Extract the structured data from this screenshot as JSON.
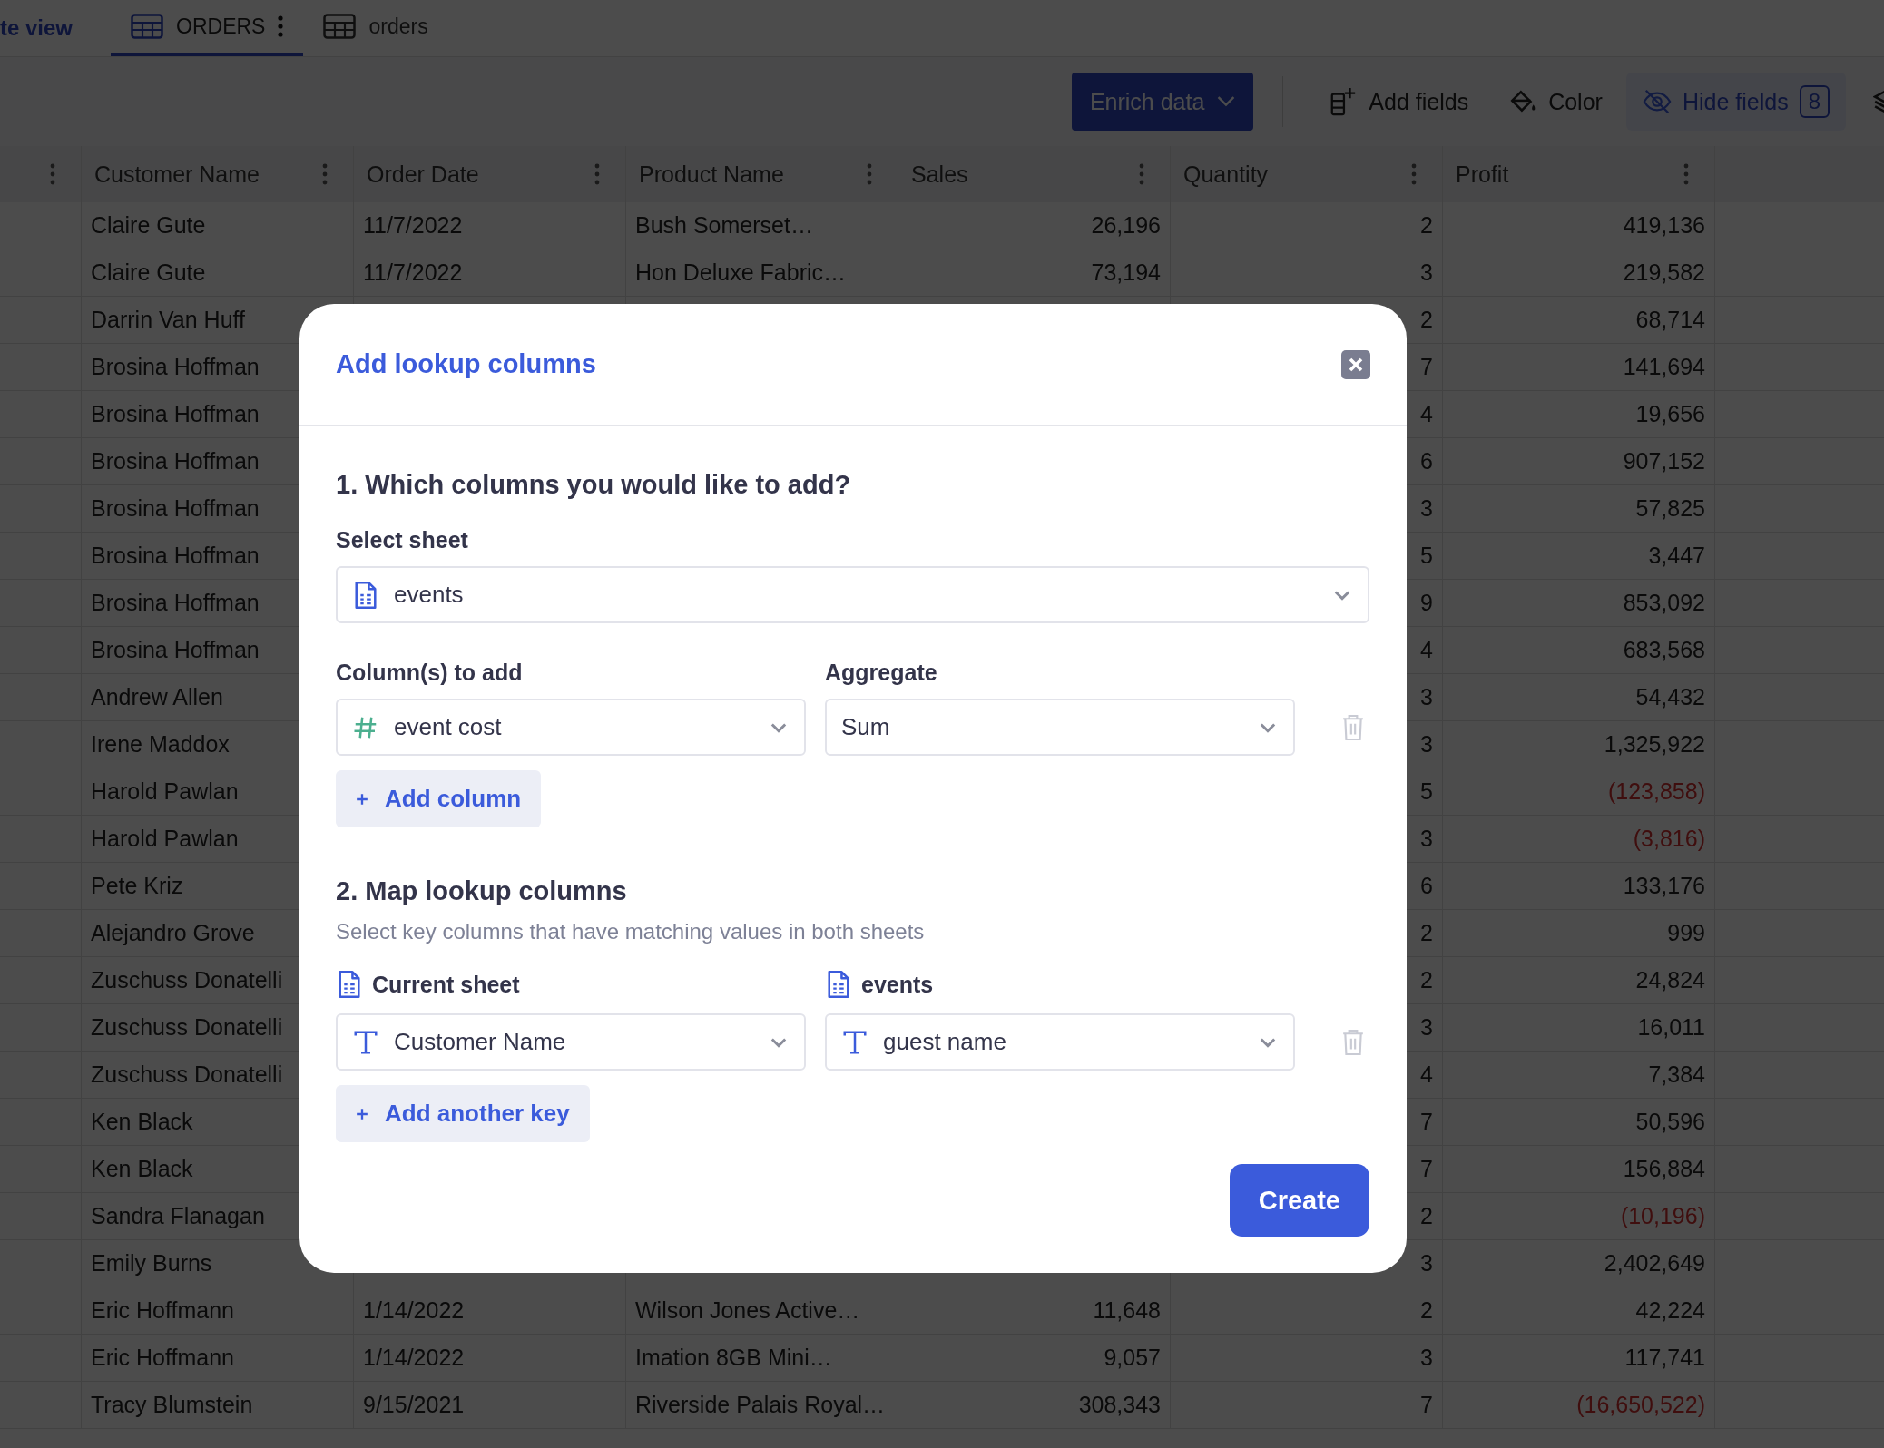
{
  "view_link": "te view",
  "tabs": [
    {
      "label": "ORDERS",
      "selected": true,
      "menu": true
    },
    {
      "label": "orders",
      "selected": false,
      "menu": false
    }
  ],
  "toolbar": {
    "enrich": "Enrich data",
    "add_fields": "Add fields",
    "color_label": "Color",
    "hide_fields": "Hide fields",
    "hidden_count": "8"
  },
  "table": {
    "columns": [
      "Customer Name",
      "Order Date",
      "Product Name",
      "Sales",
      "Quantity",
      "Profit"
    ],
    "rows": [
      {
        "cells": [
          "Claire Gute",
          "11/7/2022",
          "Bush Somerset…",
          "26,196",
          "2",
          "419,136"
        ],
        "negative": false
      },
      {
        "cells": [
          "Claire Gute",
          "11/7/2022",
          "Hon Deluxe Fabric…",
          "73,194",
          "3",
          "219,582"
        ],
        "negative": false
      },
      {
        "cells": [
          "Darrin Van Huff",
          "",
          "",
          "",
          "2",
          "68,714"
        ],
        "negative": false
      },
      {
        "cells": [
          "Brosina Hoffman",
          "",
          "",
          "",
          "7",
          "141,694"
        ],
        "negative": false
      },
      {
        "cells": [
          "Brosina Hoffman",
          "",
          "",
          "",
          "4",
          "19,656"
        ],
        "negative": false
      },
      {
        "cells": [
          "Brosina Hoffman",
          "",
          "",
          "",
          "6",
          "907,152"
        ],
        "negative": false
      },
      {
        "cells": [
          "Brosina Hoffman",
          "",
          "",
          "",
          "3",
          "57,825"
        ],
        "negative": false
      },
      {
        "cells": [
          "Brosina Hoffman",
          "",
          "",
          "",
          "5",
          "3,447"
        ],
        "negative": false
      },
      {
        "cells": [
          "Brosina Hoffman",
          "",
          "",
          "",
          "9",
          "853,092"
        ],
        "negative": false
      },
      {
        "cells": [
          "Brosina Hoffman",
          "",
          "",
          "",
          "4",
          "683,568"
        ],
        "negative": false
      },
      {
        "cells": [
          "Andrew Allen",
          "",
          "",
          "",
          "3",
          "54,432"
        ],
        "negative": false
      },
      {
        "cells": [
          "Irene Maddox",
          "",
          "",
          "",
          "3",
          "1,325,922"
        ],
        "negative": false
      },
      {
        "cells": [
          "Harold Pawlan",
          "",
          "",
          "",
          "5",
          "(123,858)"
        ],
        "negative": true
      },
      {
        "cells": [
          "Harold Pawlan",
          "",
          "",
          "",
          "3",
          "(3,816)"
        ],
        "negative": true
      },
      {
        "cells": [
          "Pete Kriz",
          "",
          "",
          "",
          "6",
          "133,176"
        ],
        "negative": false
      },
      {
        "cells": [
          "Alejandro Grove",
          "",
          "",
          "",
          "2",
          "999"
        ],
        "negative": false
      },
      {
        "cells": [
          "Zuschuss Donatelli",
          "",
          "",
          "",
          "2",
          "24,824"
        ],
        "negative": false
      },
      {
        "cells": [
          "Zuschuss Donatelli",
          "",
          "",
          "",
          "3",
          "16,011"
        ],
        "negative": false
      },
      {
        "cells": [
          "Zuschuss Donatelli",
          "",
          "",
          "",
          "4",
          "7,384"
        ],
        "negative": false
      },
      {
        "cells": [
          "Ken Black",
          "",
          "",
          "",
          "7",
          "50,596"
        ],
        "negative": false
      },
      {
        "cells": [
          "Ken Black",
          "",
          "",
          "",
          "7",
          "156,884"
        ],
        "negative": false
      },
      {
        "cells": [
          "Sandra Flanagan",
          "",
          "",
          "",
          "2",
          "(10,196)"
        ],
        "negative": true
      },
      {
        "cells": [
          "Emily Burns",
          "",
          "",
          "",
          "3",
          "2,402,649"
        ],
        "negative": false
      },
      {
        "cells": [
          "Eric Hoffmann",
          "1/14/2022",
          "Wilson Jones Active…",
          "11,648",
          "2",
          "42,224"
        ],
        "negative": false
      },
      {
        "cells": [
          "Eric Hoffmann",
          "1/14/2022",
          "Imation 8GB Mini…",
          "9,057",
          "3",
          "117,741"
        ],
        "negative": false
      },
      {
        "cells": [
          "Tracy Blumstein",
          "9/15/2021",
          "Riverside Palais Royal…",
          "308,343",
          "7",
          "(16,650,522)"
        ],
        "negative": true
      }
    ]
  },
  "dialog": {
    "title": "Add lookup columns",
    "section_1": {
      "heading": "1. Which columns you would like to add?",
      "sheet_label": "Select sheet",
      "sheet": {
        "kind": "sheet",
        "value": "events"
      },
      "columns_label": "Column(s) to add",
      "aggregate_label": "Aggregate",
      "column_rows": [
        {
          "column": {
            "kind": "number",
            "value": "event cost"
          },
          "aggregate": {
            "value": "Sum"
          }
        }
      ],
      "add_button": "Add column"
    },
    "section_2": {
      "heading": "2. Map lookup columns",
      "description": "Select key columns that have matching values in both sheets",
      "left_label": "Current sheet",
      "right_label": "events",
      "key_rows": [
        {
          "left": {
            "kind": "text",
            "value": "Customer Name"
          },
          "right": {
            "kind": "text",
            "value": "guest name"
          }
        }
      ],
      "add_button": "Add another key"
    },
    "create_button": "Create"
  }
}
